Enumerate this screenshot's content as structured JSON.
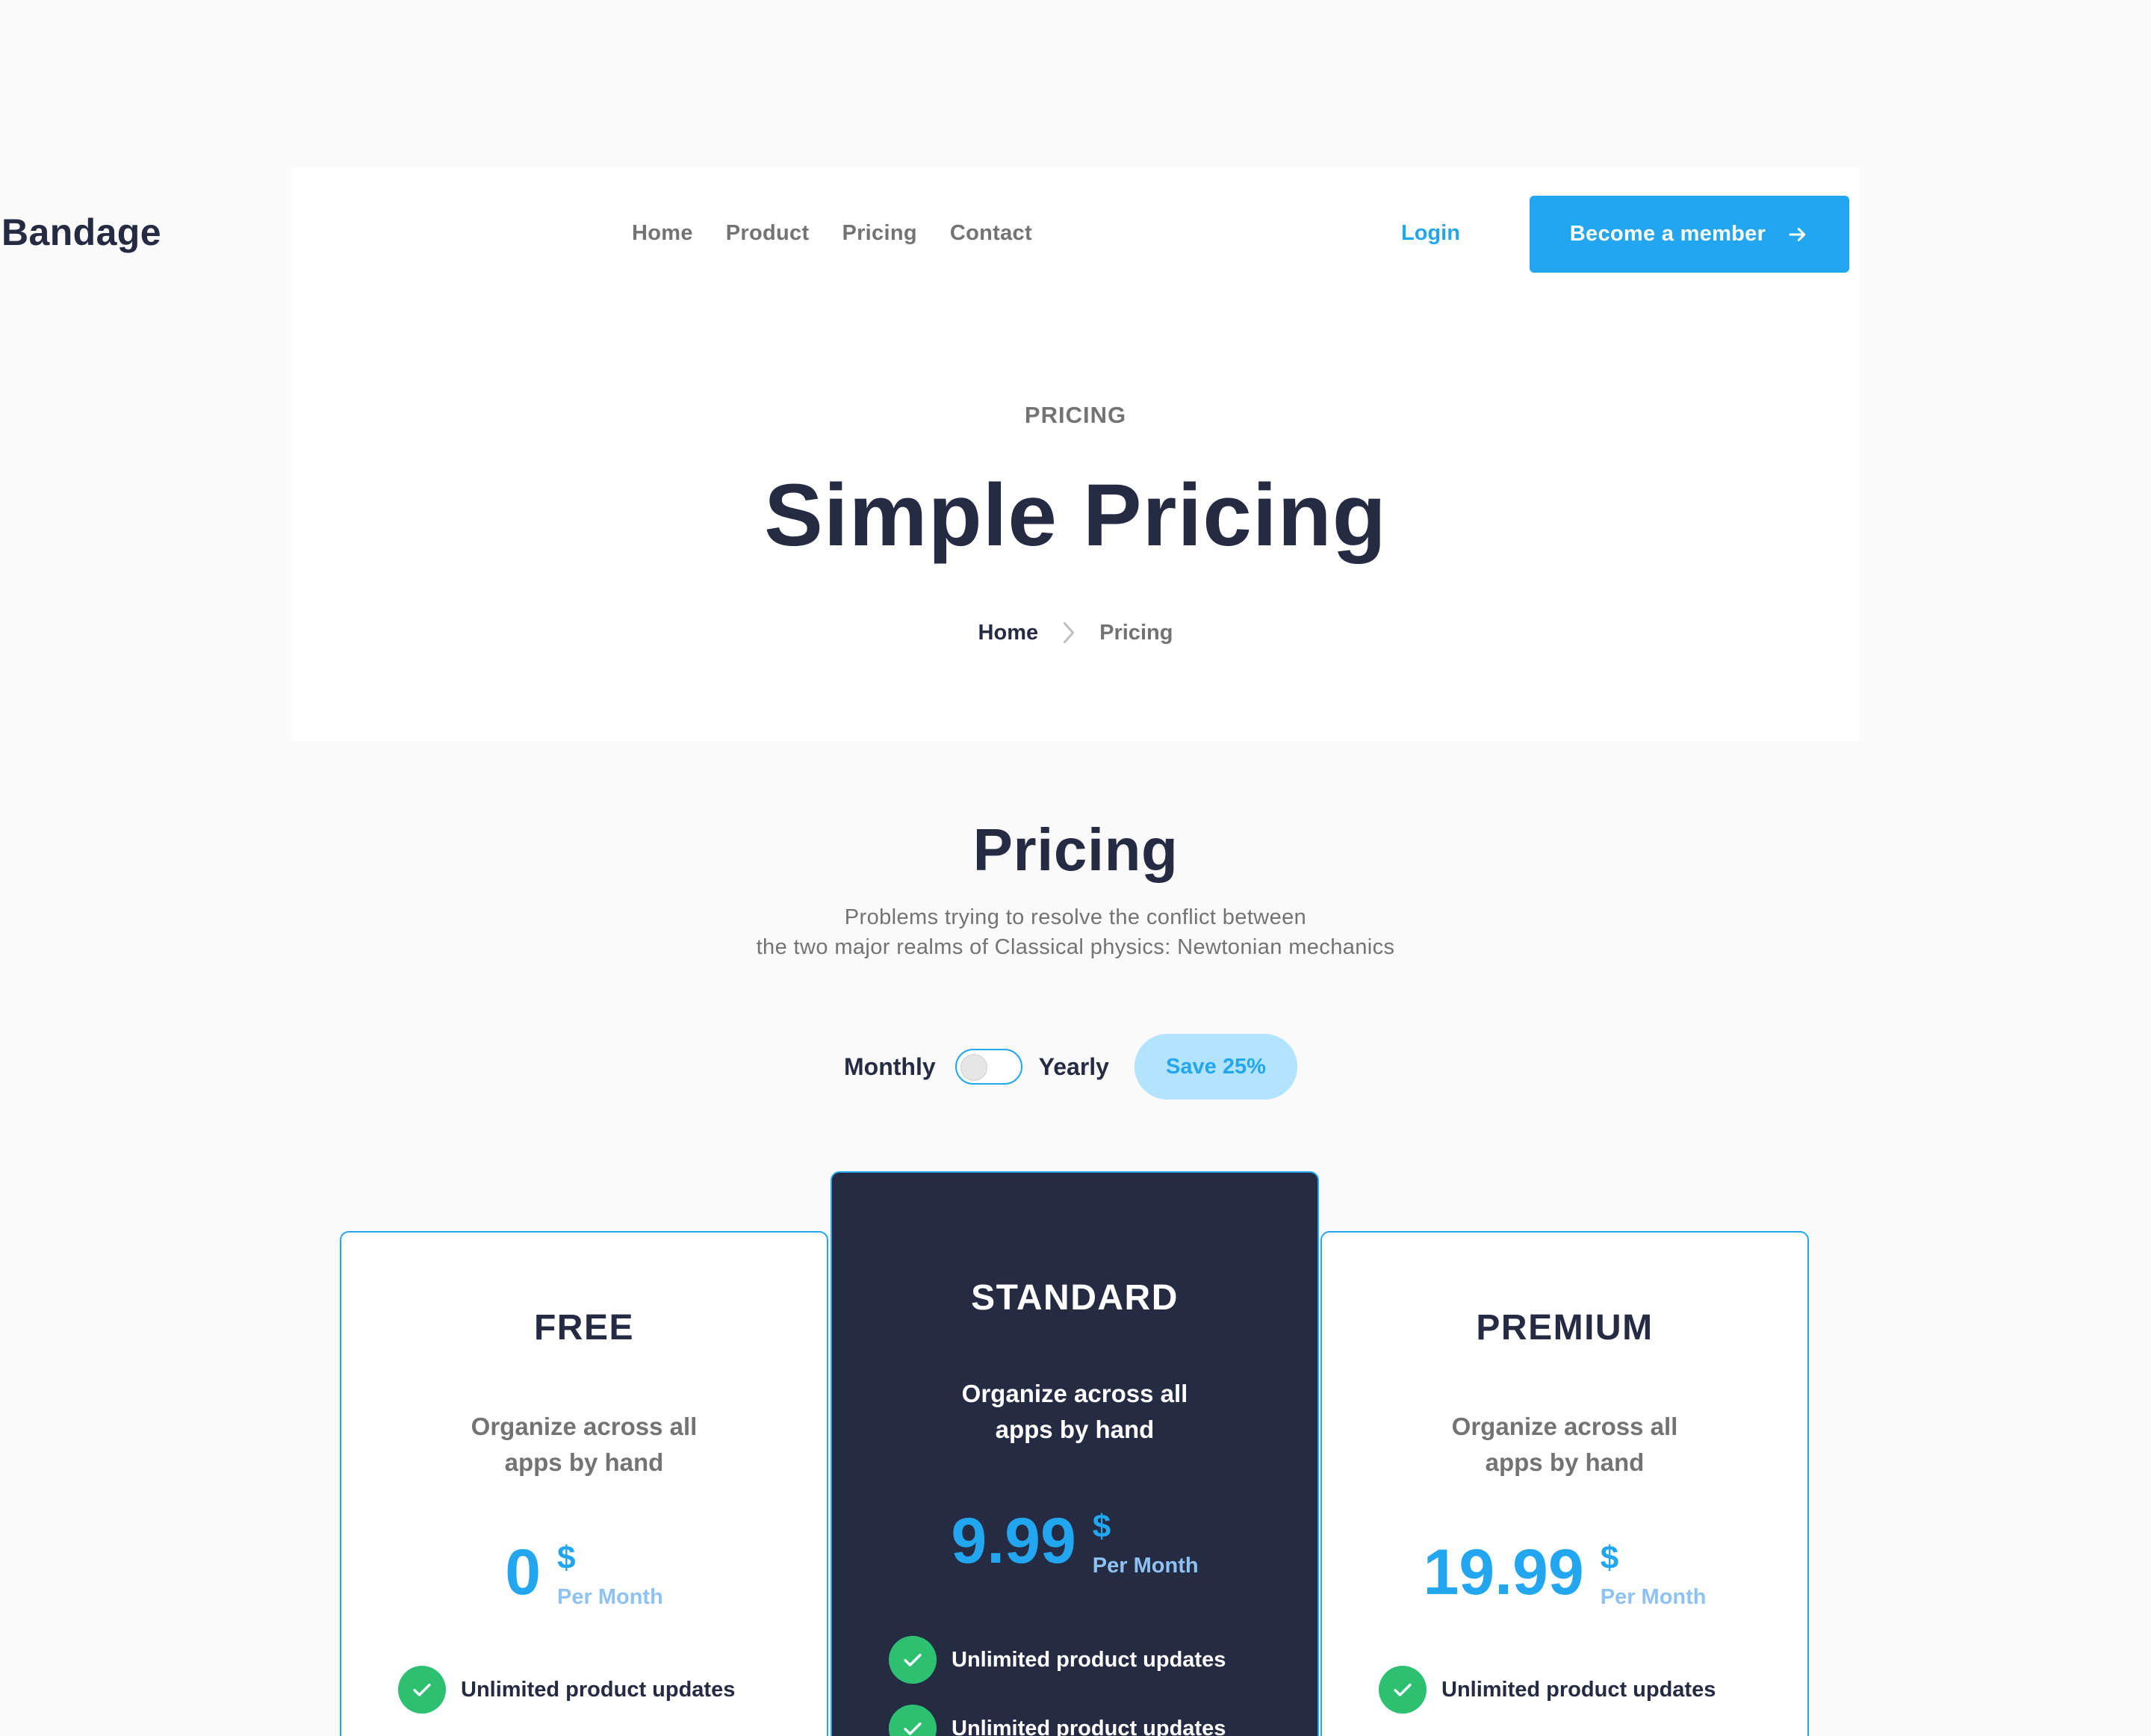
{
  "brand": {
    "logo": "Bandage"
  },
  "nav": {
    "items": [
      "Home",
      "Product",
      "Pricing",
      "Contact"
    ],
    "login": "Login",
    "cta": "Become a member"
  },
  "hero": {
    "eyebrow": "PRICING",
    "title": "Simple Pricing",
    "breadcrumb": {
      "home": "Home",
      "current": "Pricing"
    }
  },
  "pricing": {
    "title": "Pricing",
    "desc_line1": "Problems trying to resolve the conflict between",
    "desc_line2": "the two major realms of Classical physics: Newtonian mechanics",
    "toggle": {
      "monthly": "Monthly",
      "yearly": "Yearly",
      "save": "Save 25%"
    },
    "plans": [
      {
        "name": "FREE",
        "desc1": "Organize across all",
        "desc2": "apps by hand",
        "price": "0",
        "currency": "$",
        "period": "Per Month",
        "features": [
          "Unlimited product updates"
        ]
      },
      {
        "name": "STANDARD",
        "desc1": "Organize across all",
        "desc2": "apps by hand",
        "price": "9.99",
        "currency": "$",
        "period": "Per Month",
        "features": [
          "Unlimited product updates",
          "Unlimited product updates"
        ]
      },
      {
        "name": "PREMIUM",
        "desc1": "Organize across all",
        "desc2": "apps by hand",
        "price": "19.99",
        "currency": "$",
        "period": "Per Month",
        "features": [
          "Unlimited product updates"
        ]
      }
    ]
  },
  "colors": {
    "primary": "#23a6f0",
    "dark": "#252b42",
    "muted": "#737373",
    "success": "#2dc071",
    "save_pill_bg": "#b2e3ff"
  },
  "icons": {
    "cta": "arrow-right-icon",
    "breadcrumb_separator": "chevron-right-icon",
    "feature": "check-icon"
  }
}
